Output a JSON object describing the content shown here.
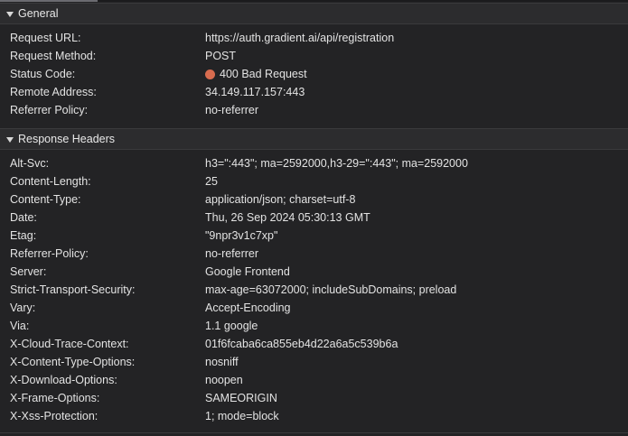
{
  "general": {
    "title": "General",
    "rows": [
      {
        "name": "Request URL:",
        "value": "https://auth.gradient.ai/api/registration"
      },
      {
        "name": "Request Method:",
        "value": "POST"
      },
      {
        "name": "Status Code:",
        "value": "400 Bad Request"
      },
      {
        "name": "Remote Address:",
        "value": "34.149.117.157:443"
      },
      {
        "name": "Referrer Policy:",
        "value": "no-referrer"
      }
    ],
    "status_color": "#d86c4f"
  },
  "response_headers": {
    "title": "Response Headers",
    "rows": [
      {
        "name": "Alt-Svc:",
        "value": "h3=\":443\"; ma=2592000,h3-29=\":443\"; ma=2592000"
      },
      {
        "name": "Content-Length:",
        "value": "25"
      },
      {
        "name": "Content-Type:",
        "value": "application/json; charset=utf-8"
      },
      {
        "name": "Date:",
        "value": "Thu, 26 Sep 2024 05:30:13 GMT"
      },
      {
        "name": "Etag:",
        "value": "\"9npr3v1c7xp\""
      },
      {
        "name": "Referrer-Policy:",
        "value": "no-referrer"
      },
      {
        "name": "Server:",
        "value": "Google Frontend"
      },
      {
        "name": "Strict-Transport-Security:",
        "value": "max-age=63072000; includeSubDomains; preload"
      },
      {
        "name": "Vary:",
        "value": "Accept-Encoding"
      },
      {
        "name": "Via:",
        "value": "1.1 google"
      },
      {
        "name": "X-Cloud-Trace-Context:",
        "value": "01f6fcaba6ca855eb4d22a6a5c539b6a"
      },
      {
        "name": "X-Content-Type-Options:",
        "value": "nosniff"
      },
      {
        "name": "X-Download-Options:",
        "value": "noopen"
      },
      {
        "name": "X-Frame-Options:",
        "value": "SAMEORIGIN"
      },
      {
        "name": "X-Xss-Protection:",
        "value": "1; mode=block"
      }
    ]
  },
  "icons": {
    "collapse_toggle": "triangle-down-icon",
    "status_indicator": "status-dot-icon"
  }
}
